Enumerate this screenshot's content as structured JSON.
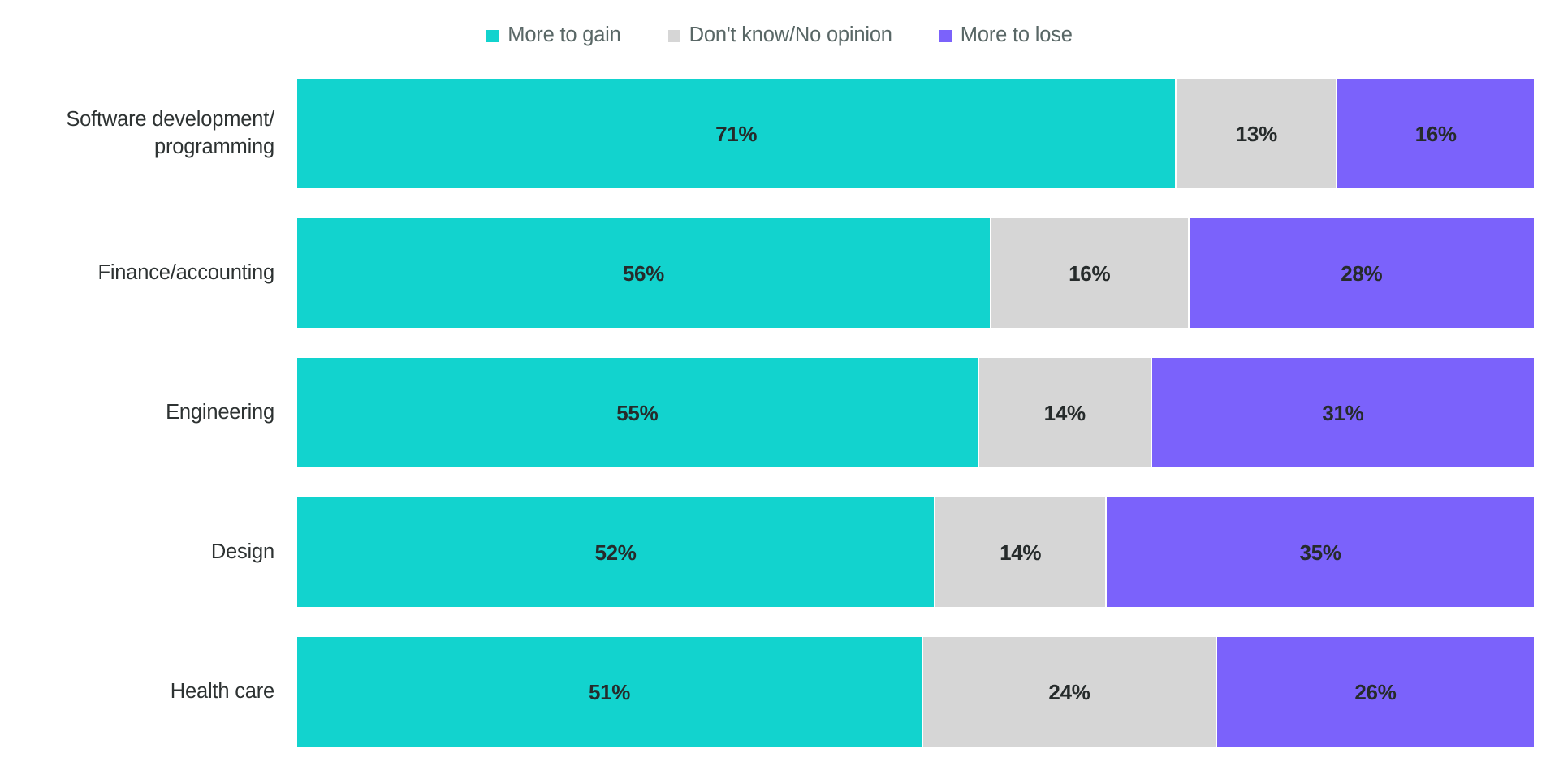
{
  "legend": {
    "items": [
      {
        "label": "More to gain",
        "color": "#12d3ce",
        "icon": "legend-square-icon"
      },
      {
        "label": "Don't know/No opinion",
        "color": "#d6d6d6",
        "icon": "legend-square-icon"
      },
      {
        "label": "More to lose",
        "color": "#7b62fb",
        "icon": "legend-square-icon"
      }
    ]
  },
  "chart_data": {
    "type": "bar",
    "orientation": "horizontal",
    "stacked": true,
    "stack_normalized": true,
    "title": "",
    "subtitle": "",
    "xlabel": "",
    "ylabel": "",
    "xlim": [
      0,
      100
    ],
    "grid": false,
    "legend_position": "top-center",
    "value_suffix": "%",
    "categories": [
      "Software development/\nprogramming",
      "Finance/accounting",
      "Engineering",
      "Design",
      "Health care"
    ],
    "series": [
      {
        "name": "More to gain",
        "color": "#12d3ce",
        "values": [
          71,
          56,
          55,
          52,
          51
        ]
      },
      {
        "name": "Don't know/No opinion",
        "color": "#d6d6d6",
        "values": [
          13,
          16,
          14,
          14,
          24
        ]
      },
      {
        "name": "More to lose",
        "color": "#7b62fb",
        "values": [
          16,
          28,
          31,
          35,
          26
        ]
      }
    ],
    "rows": [
      {
        "label": "Software development/\nprogramming",
        "segments": [
          {
            "series": "More to gain",
            "value": 71,
            "value_label": "71%",
            "color": "#12d3ce"
          },
          {
            "series": "Don't know/No opinion",
            "value": 13,
            "value_label": "13%",
            "color": "#d6d6d6"
          },
          {
            "series": "More to lose",
            "value": 16,
            "value_label": "16%",
            "color": "#7b62fb"
          }
        ]
      },
      {
        "label": "Finance/accounting",
        "segments": [
          {
            "series": "More to gain",
            "value": 56,
            "value_label": "56%",
            "color": "#12d3ce"
          },
          {
            "series": "Don't know/No opinion",
            "value": 16,
            "value_label": "16%",
            "color": "#d6d6d6"
          },
          {
            "series": "More to lose",
            "value": 28,
            "value_label": "28%",
            "color": "#7b62fb"
          }
        ]
      },
      {
        "label": "Engineering",
        "segments": [
          {
            "series": "More to gain",
            "value": 55,
            "value_label": "55%",
            "color": "#12d3ce"
          },
          {
            "series": "Don't know/No opinion",
            "value": 14,
            "value_label": "14%",
            "color": "#d6d6d6"
          },
          {
            "series": "More to lose",
            "value": 31,
            "value_label": "31%",
            "color": "#7b62fb"
          }
        ]
      },
      {
        "label": "Design",
        "segments": [
          {
            "series": "More to gain",
            "value": 52,
            "value_label": "52%",
            "color": "#12d3ce"
          },
          {
            "series": "Don't know/No opinion",
            "value": 14,
            "value_label": "14%",
            "color": "#d6d6d6"
          },
          {
            "series": "More to lose",
            "value": 35,
            "value_label": "35%",
            "color": "#7b62fb"
          }
        ]
      },
      {
        "label": "Health care",
        "segments": [
          {
            "series": "More to gain",
            "value": 51,
            "value_label": "51%",
            "color": "#12d3ce"
          },
          {
            "series": "Don't know/No opinion",
            "value": 24,
            "value_label": "24%",
            "color": "#d6d6d6"
          },
          {
            "series": "More to lose",
            "value": 26,
            "value_label": "26%",
            "color": "#7b62fb"
          }
        ]
      }
    ]
  }
}
